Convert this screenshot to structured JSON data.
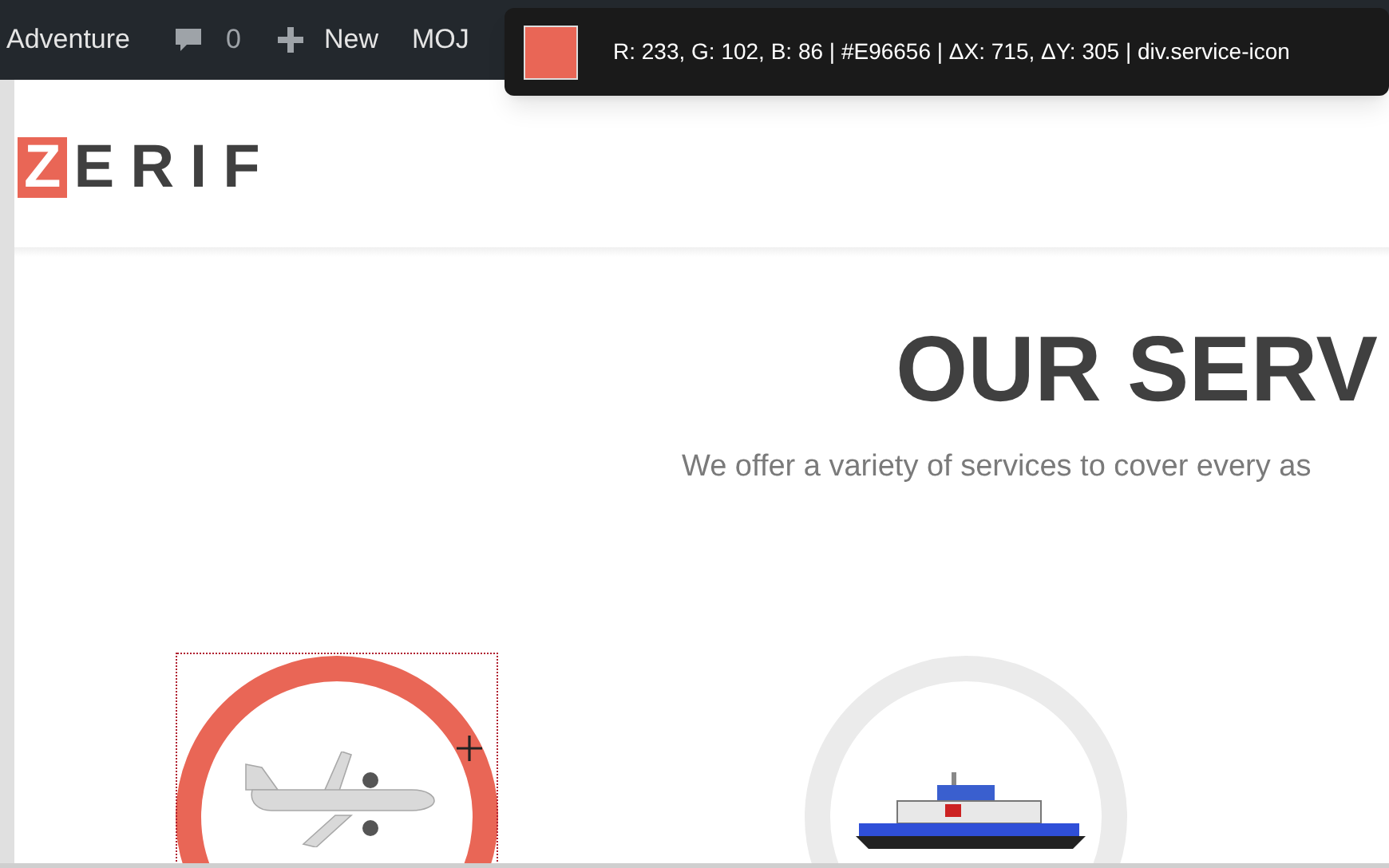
{
  "admin_bar": {
    "site_name": "Adventure",
    "comments_count": "0",
    "new_label": "New",
    "menu_item": "MOJ"
  },
  "color_picker_tooltip": {
    "color": "#e96656",
    "readout": "R: 233, G: 102, B: 86 | #E96656 | ΔX: 715, ΔY: 305 | div.service-icon"
  },
  "logo": {
    "initial": "Z",
    "rest": "ERIF"
  },
  "section": {
    "title": "OUR SERV",
    "subtitle": "We offer a variety of services to cover every as"
  },
  "services": [
    {
      "kind": "airplane",
      "highlighted": true
    },
    {
      "kind": "ferry",
      "highlighted": false
    }
  ]
}
